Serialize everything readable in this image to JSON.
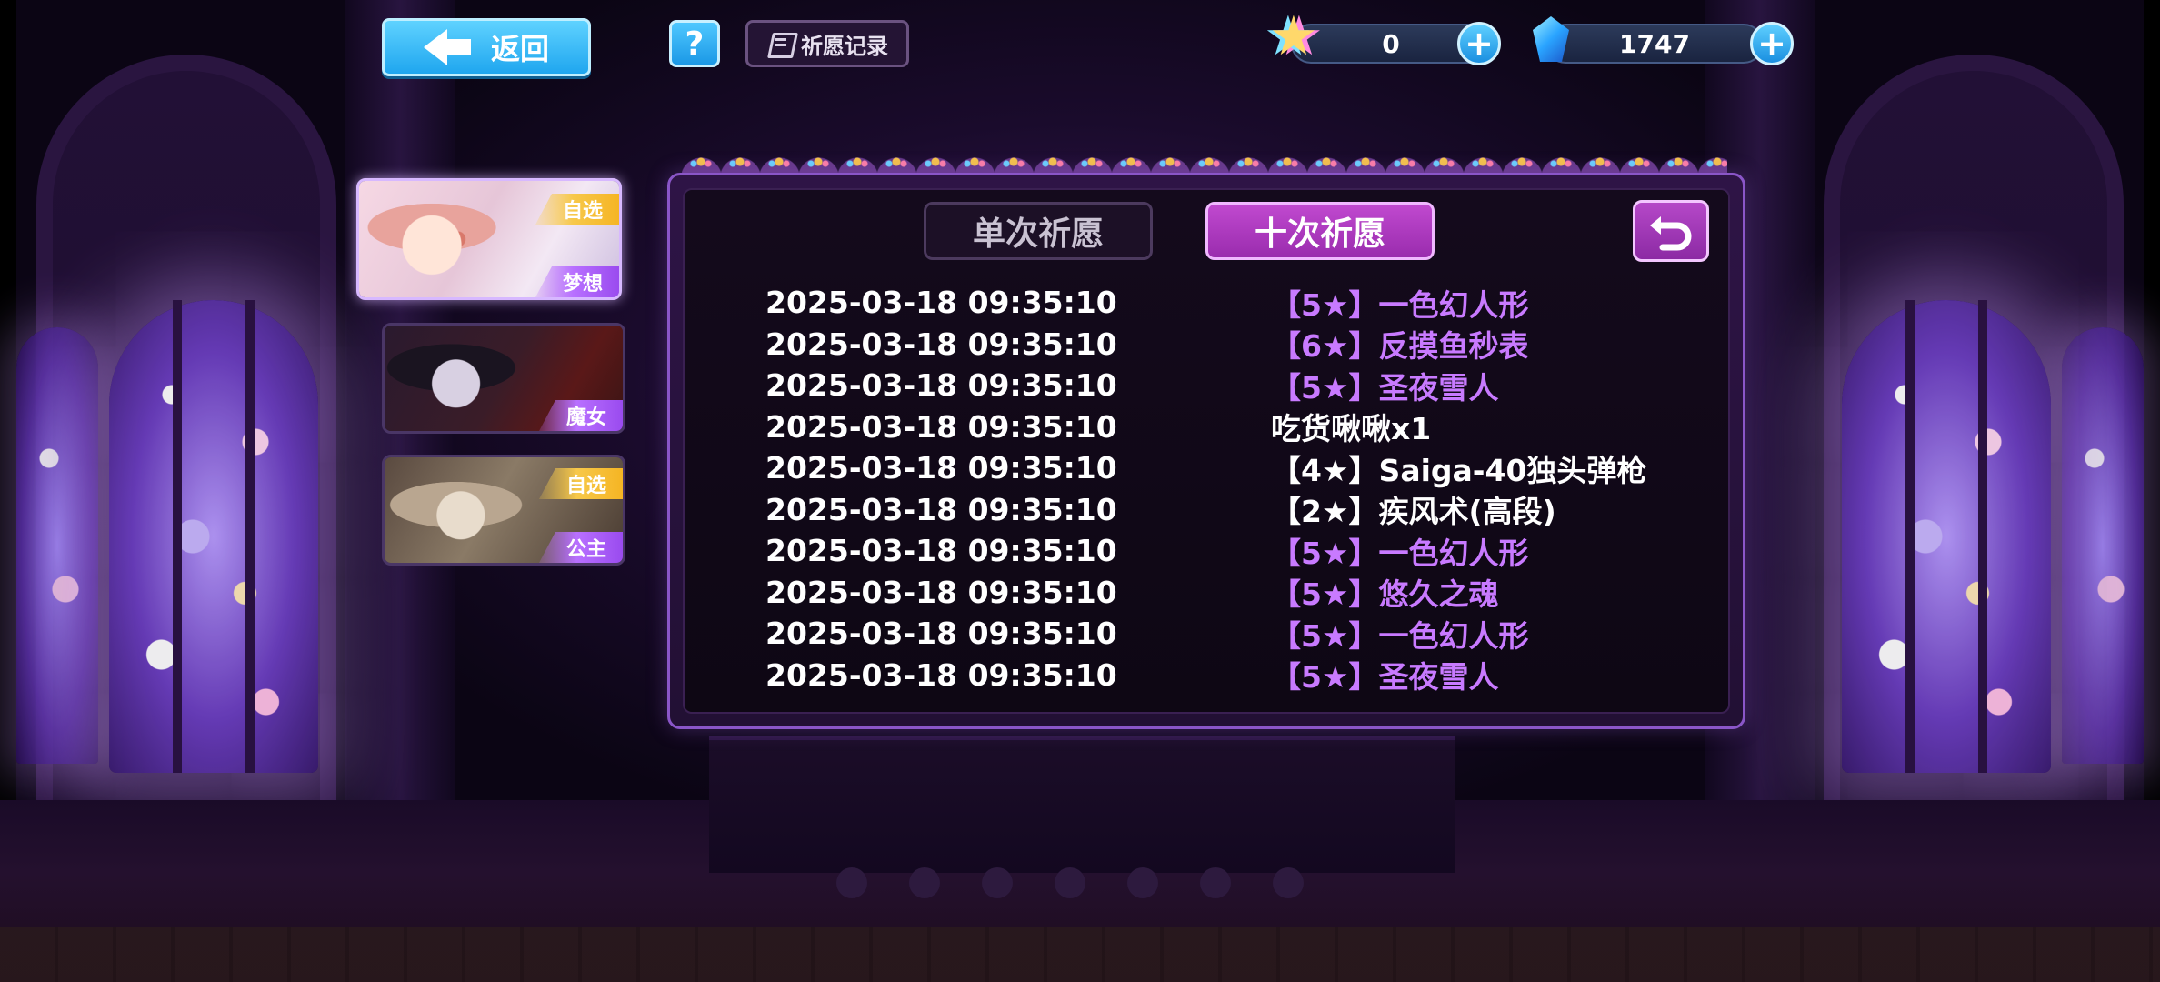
{
  "top_bar": {
    "back_label": "返回",
    "help_label": "?",
    "record_label": "祈愿记录",
    "currency_star": {
      "icon": "rainbow-star-icon",
      "value": "0"
    },
    "currency_gem": {
      "icon": "blue-crystal-icon",
      "value": "1747"
    },
    "plus_label": "+"
  },
  "banners": [
    {
      "name": "梦想",
      "pick_tag": "自选",
      "active": true
    },
    {
      "name": "魔女",
      "pick_tag": "",
      "active": false
    },
    {
      "name": "公主",
      "pick_tag": "自选",
      "active": false
    }
  ],
  "tabs": {
    "single": "单次祈愿",
    "ten": "十次祈愿",
    "active": "ten"
  },
  "records": [
    {
      "time": "2025-03-18 09:35:10",
      "item": "【5★】一色幻人形",
      "color": "purple"
    },
    {
      "time": "2025-03-18 09:35:10",
      "item": "【6★】反摸鱼秒表",
      "color": "purple"
    },
    {
      "time": "2025-03-18 09:35:10",
      "item": "【5★】圣夜雪人",
      "color": "purple"
    },
    {
      "time": "2025-03-18 09:35:10",
      "item": "吃货啾啾x1",
      "color": "white"
    },
    {
      "time": "2025-03-18 09:35:10",
      "item": "【4★】Saiga-40独头弹枪",
      "color": "white"
    },
    {
      "time": "2025-03-18 09:35:10",
      "item": "【2★】疾风术(高段)",
      "color": "white"
    },
    {
      "time": "2025-03-18 09:35:10",
      "item": "【5★】一色幻人形",
      "color": "purple"
    },
    {
      "time": "2025-03-18 09:35:10",
      "item": "【5★】悠久之魂",
      "color": "purple"
    },
    {
      "time": "2025-03-18 09:35:10",
      "item": "【5★】一色幻人形",
      "color": "purple"
    },
    {
      "time": "2025-03-18 09:35:10",
      "item": "【5★】圣夜雪人",
      "color": "purple"
    }
  ],
  "colors": {
    "accent": "#b548c8",
    "high_rarity": "#c87aff",
    "button_blue": "#1fa6ef"
  }
}
